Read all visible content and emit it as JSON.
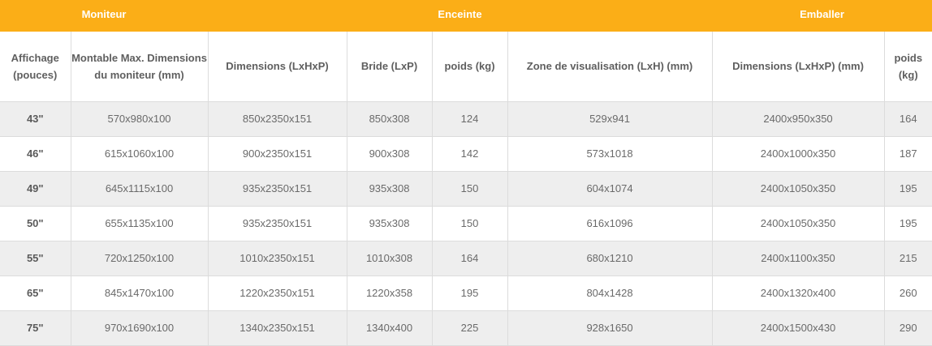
{
  "groups": {
    "moniteur": "Moniteur",
    "enceinte": "Enceinte",
    "emballer": "Emballer"
  },
  "columns": [
    "Affichage (pouces)",
    "Montable Max. Dimensions du moniteur (mm)",
    "Dimensions (LxHxP)",
    "Bride (LxP)",
    "poids (kg)",
    "Zone de visualisation (LxH) (mm)",
    "Dimensions (LxHxP) (mm)",
    "poids (kg)"
  ],
  "rows": [
    [
      "43\"",
      "570x980x100",
      "850x2350x151",
      "850x308",
      "124",
      "529x941",
      "2400x950x350",
      "164"
    ],
    [
      "46\"",
      "615x1060x100",
      "900x2350x151",
      "900x308",
      "142",
      "573x1018",
      "2400x1000x350",
      "187"
    ],
    [
      "49\"",
      "645x1115x100",
      "935x2350x151",
      "935x308",
      "150",
      "604x1074",
      "2400x1050x350",
      "195"
    ],
    [
      "50\"",
      "655x1135x100",
      "935x2350x151",
      "935x308",
      "150",
      "616x1096",
      "2400x1050x350",
      "195"
    ],
    [
      "55\"",
      "720x1250x100",
      "1010x2350x151",
      "1010x308",
      "164",
      "680x1210",
      "2400x1100x350",
      "215"
    ],
    [
      "65\"",
      "845x1470x100",
      "1220x2350x151",
      "1220x358",
      "195",
      "804x1428",
      "2400x1320x400",
      "260"
    ],
    [
      "75\"",
      "970x1690x100",
      "1340x2350x151",
      "1340x400",
      "225",
      "928x1650",
      "2400x1500x430",
      "290"
    ]
  ]
}
